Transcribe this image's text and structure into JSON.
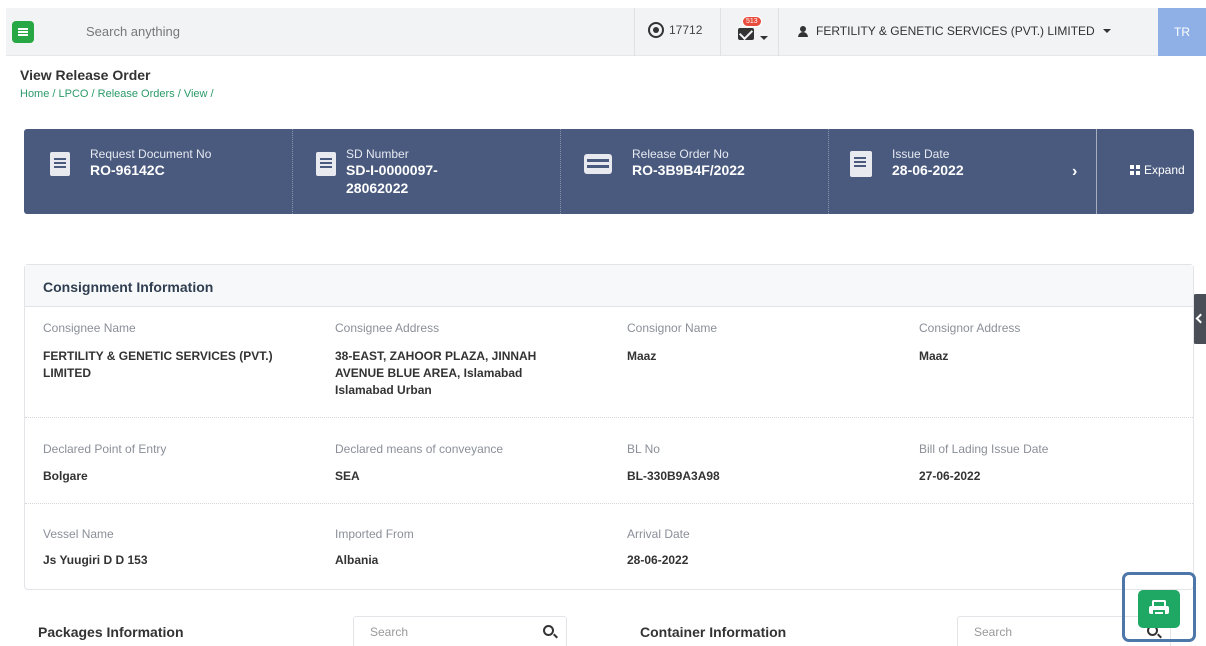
{
  "header": {
    "search_placeholder": "Search anything",
    "coin_count": "17712",
    "mail_badge": "513",
    "user_name": "FERTILITY & GENETIC SERVICES (PVT.) LIMITED",
    "avatar_initials": "TR"
  },
  "page": {
    "title": "View Release Order",
    "breadcrumb": "Home / LPCO / Release Orders / View /"
  },
  "summary": {
    "request_label": "Request Document No",
    "request_value": "RO-96142C",
    "sd_label": "SD Number",
    "sd_value_line1": "SD-I-0000097-",
    "sd_value_line2": "28062022",
    "release_label": "Release Order No",
    "release_value": "RO-3B9B4F/2022",
    "issue_label": "Issue Date",
    "issue_value": "28-06-2022",
    "expand_label": "Expand"
  },
  "consignment": {
    "title": "Consignment Information",
    "consignee_name_label": "Consignee Name",
    "consignee_name_line1": "FERTILITY & GENETIC SERVICES (PVT.)",
    "consignee_name_line2": "LIMITED",
    "consignee_address_label": "Consignee Address",
    "consignee_address_line1": "38-EAST, ZAHOOR PLAZA, JINNAH",
    "consignee_address_line2": "AVENUE BLUE AREA, Islamabad",
    "consignee_address_line3": "Islamabad Urban",
    "consignor_name_label": "Consignor Name",
    "consignor_name": "Maaz",
    "consignor_address_label": "Consignor Address",
    "consignor_address": "Maaz",
    "point_of_entry_label": "Declared Point of Entry",
    "point_of_entry": "Bolgare",
    "conveyance_label": "Declared means of conveyance",
    "conveyance": "SEA",
    "bl_no_label": "BL No",
    "bl_no": "BL-330B9A3A98",
    "bl_date_label": "Bill of Lading Issue Date",
    "bl_date": "27-06-2022",
    "vessel_label": "Vessel Name",
    "vessel": "Js Yuugiri D D 153",
    "imported_from_label": "Imported From",
    "imported_from": "Albania",
    "arrival_date_label": "Arrival Date",
    "arrival_date": "28-06-2022"
  },
  "packages": {
    "title": "Packages Information",
    "search_placeholder": "Search"
  },
  "containers": {
    "title": "Container Information",
    "search_placeholder": "Search"
  }
}
